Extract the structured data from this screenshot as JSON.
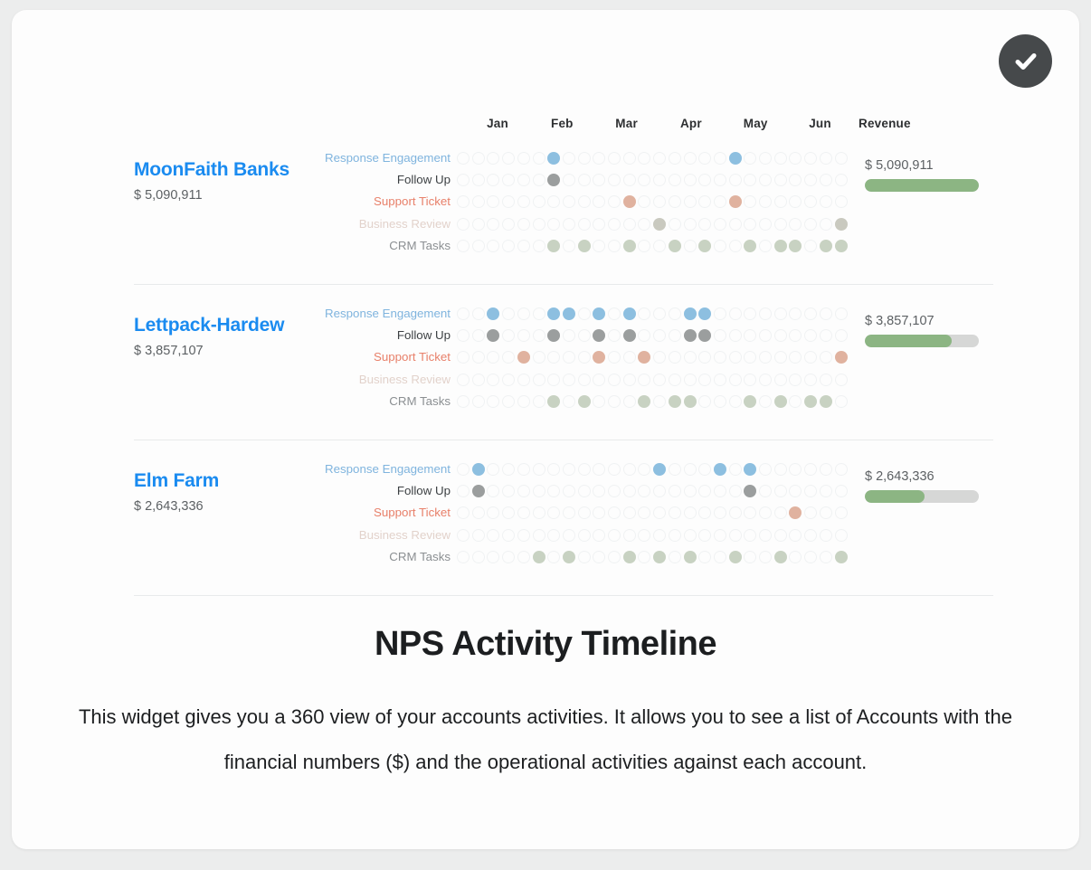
{
  "widget": {
    "title": "NPS Activity Timeline",
    "description": "This widget gives you a 360 view of your accounts activities. It allows you to see a list of Accounts with the financial numbers ($) and the operational activities against each account.",
    "status_icon": "check-circle-icon"
  },
  "columns": {
    "months": [
      "Jan",
      "Feb",
      "Mar",
      "Apr",
      "May",
      "Jun"
    ],
    "revenue_header": "Revenue",
    "slots": 26
  },
  "metrics": [
    {
      "label": "Response Engagement",
      "color": "#8dbfe0",
      "label_color": "#7fb4de"
    },
    {
      "label": "Follow Up",
      "color": "#9b9e9e",
      "label_color": "#3c4043"
    },
    {
      "label": "Support Ticket",
      "color": "#e0b29f",
      "label_color": "#e8806a"
    },
    {
      "label": "Business Review",
      "color": "#c9c9bf",
      "label_color": "#e2d2cb"
    },
    {
      "label": "CRM Tasks",
      "color": "#c8d2c2",
      "label_color": "#8b8f92"
    }
  ],
  "colors": {
    "accent_blue": "#1a8bf0",
    "revenue_fill": "#8cb583",
    "revenue_track": "#d6d7d6",
    "badge": "#46494b",
    "card": "#fdfdfd",
    "page": "#eceded"
  },
  "accounts": [
    {
      "name": "MoonFaith Banks",
      "revenue_text": "$ 5,090,911",
      "revenue_value": 5090911,
      "revenue_pct": 100,
      "activity": [
        [
          7,
          19
        ],
        [
          7
        ],
        [
          12,
          19
        ],
        [
          14,
          26
        ],
        [
          7,
          9,
          12,
          15,
          17,
          20,
          22,
          23,
          25,
          26
        ]
      ]
    },
    {
      "name": "Lettpack-Hardew",
      "revenue_text": "$ 3,857,107",
      "revenue_value": 3857107,
      "revenue_pct": 76,
      "activity": [
        [
          3,
          7,
          8,
          10,
          12,
          16,
          17
        ],
        [
          3,
          7,
          10,
          12,
          16,
          17
        ],
        [
          5,
          10,
          13,
          26
        ],
        [],
        [
          7,
          9,
          13,
          15,
          16,
          20,
          22,
          24,
          25
        ]
      ]
    },
    {
      "name": "Elm Farm",
      "revenue_text": "$ 2,643,336",
      "revenue_value": 2643336,
      "revenue_pct": 52,
      "activity": [
        [
          2,
          14,
          18,
          20
        ],
        [
          2,
          20
        ],
        [
          23
        ],
        [],
        [
          6,
          8,
          12,
          14,
          16,
          19,
          22,
          26
        ]
      ]
    }
  ],
  "chart_data": {
    "type": "heatmap",
    "title": "NPS Activity Timeline",
    "xlabel": "",
    "ylabel": "",
    "x_tick_labels": [
      "Jan",
      "Feb",
      "Mar",
      "Apr",
      "May",
      "Jun"
    ],
    "x_slots": 26,
    "row_categories": [
      "Response Engagement",
      "Follow Up",
      "Support Ticket",
      "Business Review",
      "CRM Tasks"
    ],
    "grid": false,
    "legend": "none",
    "series": [
      {
        "name": "MoonFaith Banks",
        "revenue": 5090911,
        "revenue_label": "$ 5,090,911",
        "revenue_bar_pct": 100,
        "rows": [
          {
            "name": "Response Engagement",
            "active_slots": [
              7,
              19
            ]
          },
          {
            "name": "Follow Up",
            "active_slots": [
              7
            ]
          },
          {
            "name": "Support Ticket",
            "active_slots": [
              12,
              19
            ]
          },
          {
            "name": "Business Review",
            "active_slots": [
              14,
              26
            ]
          },
          {
            "name": "CRM Tasks",
            "active_slots": [
              7,
              9,
              12,
              15,
              17,
              20,
              22,
              23,
              25,
              26
            ]
          }
        ]
      },
      {
        "name": "Lettpack-Hardew",
        "revenue": 3857107,
        "revenue_label": "$ 3,857,107",
        "revenue_bar_pct": 76,
        "rows": [
          {
            "name": "Response Engagement",
            "active_slots": [
              3,
              7,
              8,
              10,
              12,
              16,
              17
            ]
          },
          {
            "name": "Follow Up",
            "active_slots": [
              3,
              7,
              10,
              12,
              16,
              17
            ]
          },
          {
            "name": "Support Ticket",
            "active_slots": [
              5,
              10,
              13,
              26
            ]
          },
          {
            "name": "Business Review",
            "active_slots": []
          },
          {
            "name": "CRM Tasks",
            "active_slots": [
              7,
              9,
              13,
              15,
              16,
              20,
              22,
              24,
              25
            ]
          }
        ]
      },
      {
        "name": "Elm Farm",
        "revenue": 2643336,
        "revenue_label": "$ 2,643,336",
        "revenue_bar_pct": 52,
        "rows": [
          {
            "name": "Response Engagement",
            "active_slots": [
              2,
              14,
              18,
              20
            ]
          },
          {
            "name": "Follow Up",
            "active_slots": [
              2,
              20
            ]
          },
          {
            "name": "Support Ticket",
            "active_slots": [
              23
            ]
          },
          {
            "name": "Business Review",
            "active_slots": []
          },
          {
            "name": "CRM Tasks",
            "active_slots": [
              6,
              8,
              12,
              14,
              16,
              19,
              22,
              26
            ]
          }
        ]
      }
    ]
  }
}
